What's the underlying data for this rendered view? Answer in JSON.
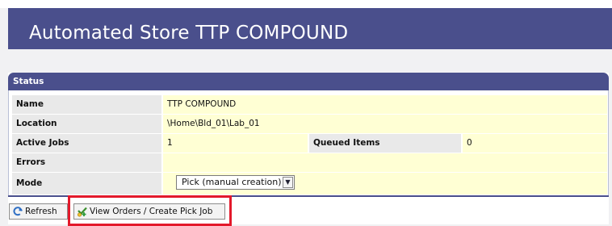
{
  "header": {
    "title": "Automated Store TTP COMPOUND"
  },
  "panel": {
    "title": "Status"
  },
  "fields": {
    "name_label": "Name",
    "name_value": "TTP COMPOUND",
    "location_label": "Location",
    "location_value": "\\Home\\Bld_01\\Lab_01",
    "active_jobs_label": "Active Jobs",
    "active_jobs_value": "1",
    "queued_items_label": "Queued Items",
    "queued_items_value": "0",
    "errors_label": "Errors",
    "errors_value": "",
    "mode_label": "Mode",
    "mode_selected": "Pick (manual creation)"
  },
  "toolbar": {
    "refresh_label": "Refresh",
    "refresh_icon": "refresh-icon",
    "view_orders_label": "View Orders / Create Pick Job",
    "view_orders_icon": "add-pick-job-icon"
  },
  "colors": {
    "header_bg": "#4a4f8c",
    "value_bg": "#ffffd4",
    "label_bg": "#e9e9e9",
    "highlight": "#e3192b"
  }
}
